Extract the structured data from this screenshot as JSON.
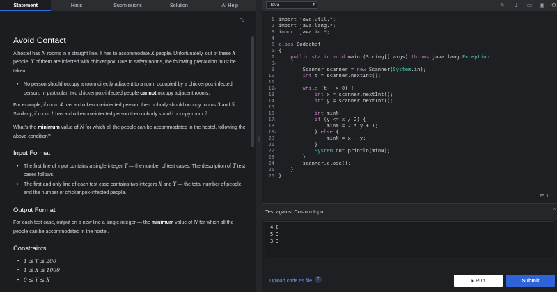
{
  "tabs": [
    "Statement",
    "Hints",
    "Submissions",
    "Solution",
    "AI Help"
  ],
  "problem": {
    "title": "Avoid Contact",
    "intro": [
      "A hostel has ",
      "N",
      " rooms in a straight line. It has to accommodate ",
      "X",
      " people. Unfortunately, out of these ",
      "X",
      " people, ",
      "Y",
      " of them are infected with chickenpox. Due to safety norms, the following precaution must be taken:"
    ],
    "bullet1": [
      "No person should occupy a room directly adjacent to a room occupied by a chickenpox-infected person. In particular, two chickenpox-infected people ",
      "cannot",
      " occupy adjacent rooms."
    ],
    "example": [
      "For example, if room ",
      "4",
      " has a chickenpox-infected person, then nobody should occupy rooms ",
      "3",
      " and ",
      "5",
      ". Similarly, if room ",
      "1",
      " has a chickenpox-infected person then nobody should occupy room ",
      "2",
      "."
    ],
    "question": [
      "What's the ",
      "minimum",
      " value of ",
      "N",
      " for which all the people can be accommodated in the hostel, following the above condition?"
    ],
    "input_heading": "Input Format",
    "input1": [
      "The first line of input contains a single integer ",
      "T",
      " — the number of test cases. The description of ",
      "T",
      " test cases follows."
    ],
    "input2": [
      "The first and only line of each test case contains two integers ",
      "X",
      " and ",
      "Y",
      " — the total number of people and the number of chickenpox-infected people."
    ],
    "output_heading": "Output Format",
    "output": [
      "For each test case, output on a new line a single integer — the ",
      "minimum",
      " value of ",
      "N",
      " for which all the people can be accommodated in the hostel."
    ],
    "constraints_heading": "Constraints",
    "constraints": [
      "1 ≤ T ≤ 200",
      "1 ≤ X ≤ 1000",
      "0 ≤ Y ≤ X"
    ]
  },
  "editor": {
    "language": "Java",
    "tool_icons": [
      "magic-wand-icon",
      "download-icon",
      "comment-icon",
      "save-icon",
      "settings-icon",
      "fullscreen-icon"
    ],
    "cursor_position": "25:1"
  },
  "code_lines": [
    [
      {
        "t": "import java.util.*;",
        "c": "pl"
      }
    ],
    [
      {
        "t": "import java.lang.*;",
        "c": "pl"
      }
    ],
    [
      {
        "t": "import java.io.*;",
        "c": "pl"
      }
    ],
    [],
    [
      {
        "t": "class ",
        "c": "kw"
      },
      {
        "t": "Codechef",
        "c": "pl"
      }
    ],
    [
      {
        "t": "{",
        "c": "pl"
      }
    ],
    [
      {
        "t": "    public static void ",
        "c": "kw"
      },
      {
        "t": "main",
        "c": "fn"
      },
      {
        "t": " (String[] args) ",
        "c": "pl"
      },
      {
        "t": "throws ",
        "c": "kw"
      },
      {
        "t": "java.lang.",
        "c": "pl"
      },
      {
        "t": "Exception",
        "c": "ty"
      }
    ],
    [
      {
        "t": "    {",
        "c": "pl"
      }
    ],
    [
      {
        "t": "        Scanner scanner = ",
        "c": "pl"
      },
      {
        "t": "new ",
        "c": "kw"
      },
      {
        "t": "Scanner(",
        "c": "pl"
      },
      {
        "t": "System",
        "c": "ty"
      },
      {
        "t": ".in);",
        "c": "pl"
      }
    ],
    [
      {
        "t": "        int ",
        "c": "kw"
      },
      {
        "t": "t = scanner.nextInt();",
        "c": "pl"
      }
    ],
    [],
    [
      {
        "t": "        while ",
        "c": "kw"
      },
      {
        "t": "(t-- > ",
        "c": "pl"
      },
      {
        "t": "0",
        "c": "nm"
      },
      {
        "t": ") {",
        "c": "pl"
      }
    ],
    [
      {
        "t": "            int ",
        "c": "kw"
      },
      {
        "t": "x = scanner.nextInt();",
        "c": "pl"
      }
    ],
    [
      {
        "t": "            int ",
        "c": "kw"
      },
      {
        "t": "y = scanner.nextInt();",
        "c": "pl"
      }
    ],
    [],
    [
      {
        "t": "            int ",
        "c": "kw"
      },
      {
        "t": "minN;",
        "c": "pl"
      }
    ],
    [
      {
        "t": "            if ",
        "c": "kw"
      },
      {
        "t": "(y <= x / ",
        "c": "pl"
      },
      {
        "t": "2",
        "c": "nm"
      },
      {
        "t": ") {",
        "c": "pl"
      }
    ],
    [
      {
        "t": "                minN = ",
        "c": "pl"
      },
      {
        "t": "2",
        "c": "nm"
      },
      {
        "t": " * y + ",
        "c": "pl"
      },
      {
        "t": "1",
        "c": "nm"
      },
      {
        "t": ";",
        "c": "pl"
      }
    ],
    [
      {
        "t": "            } ",
        "c": "pl"
      },
      {
        "t": "else ",
        "c": "kw"
      },
      {
        "t": "{",
        "c": "pl"
      }
    ],
    [
      {
        "t": "                minN = x - y;",
        "c": "pl"
      }
    ],
    [
      {
        "t": "            }",
        "c": "pl"
      }
    ],
    [
      {
        "t": "            ",
        "c": "pl"
      },
      {
        "t": "System",
        "c": "ty"
      },
      {
        "t": ".out.println(minN);",
        "c": "pl"
      }
    ],
    [
      {
        "t": "        }",
        "c": "pl"
      }
    ],
    [
      {
        "t": "        scanner.close();",
        "c": "pl"
      }
    ],
    [
      {
        "t": "    }",
        "c": "pl"
      }
    ],
    [
      {
        "t": "}",
        "c": "pl"
      }
    ]
  ],
  "custom_input": {
    "label": "Test against Custom Input",
    "lines": [
      "4 0",
      "5 3",
      "3 3"
    ]
  },
  "footer": {
    "upload_label": "Upload code as file",
    "run_label": "Run",
    "submit_label": "Submit"
  }
}
